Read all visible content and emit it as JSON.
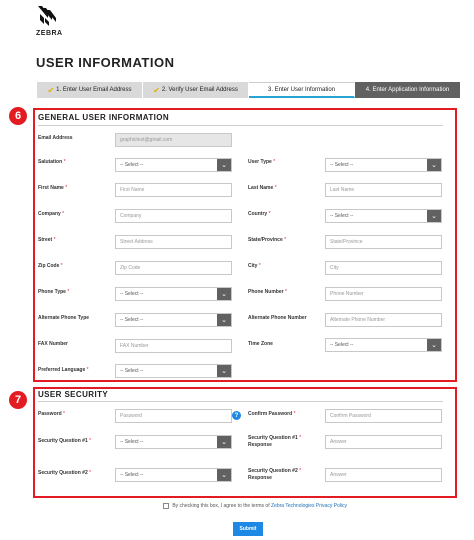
{
  "brand": {
    "name": "ZEBRA"
  },
  "page_title": "USER INFORMATION",
  "steps": [
    {
      "label": "1. Enter User Email Address",
      "done": true
    },
    {
      "label": "2. Verify User Email Address",
      "done": true
    },
    {
      "label": "3. Enter User Information",
      "active": true
    },
    {
      "label": "4. Enter Application Information"
    }
  ],
  "callouts": {
    "general": "6",
    "security": "7"
  },
  "general": {
    "title": "GENERAL USER INFORMATION",
    "email_label": "Email Address",
    "email_value": "graphictest@gmail.com",
    "salutation_label": "Salutation",
    "salutation_value": "-- Select --",
    "user_type_label": "User Type",
    "user_type_value": "-- Select --",
    "first_name_label": "First Name",
    "first_name_placeholder": "First Name",
    "last_name_label": "Last Name",
    "last_name_placeholder": "Last Name",
    "company_label": "Company",
    "company_placeholder": "Company",
    "country_label": "Country",
    "country_value": "-- Select --",
    "street_label": "Street",
    "street_placeholder": "Street Address",
    "state_label": "State/Province",
    "state_placeholder": "State/Province",
    "zip_label": "Zip Code",
    "zip_placeholder": "Zip Code",
    "city_label": "City",
    "city_placeholder": "City",
    "phone_type_label": "Phone Type",
    "phone_type_value": "-- Select --",
    "phone_number_label": "Phone Number",
    "phone_number_placeholder": "Phone Number",
    "alt_phone_type_label": "Alternate Phone Type",
    "alt_phone_type_value": "-- Select --",
    "alt_phone_number_label": "Alternate Phone Number",
    "alt_phone_number_placeholder": "Alternate Phone Number",
    "fax_label": "FAX Number",
    "fax_placeholder": "FAX Number",
    "time_zone_label": "Time Zone",
    "time_zone_value": "-- Select --",
    "language_label": "Preferred Language",
    "language_value": "-- Select --"
  },
  "security": {
    "title": "USER SECURITY",
    "password_label": "Password",
    "password_placeholder": "Password",
    "help_icon": "?",
    "confirm_label": "Confirm Password",
    "confirm_placeholder": "Confirm Password",
    "q1_label": "Security Question #1",
    "q1_value": "-- Select --",
    "q1_resp_label_line1": "Security Question #1",
    "q1_resp_label_line2": "Response",
    "q1_resp_placeholder": "Answer",
    "q2_label": "Security Question #2",
    "q2_value": "-- Select --",
    "q2_resp_label_line1": "Security Question #2",
    "q2_resp_label_line2": "Response",
    "q2_resp_placeholder": "Answer"
  },
  "consent": {
    "text": "By checking this box, I agree to the terms of",
    "link": "Zebra Technologies Privacy Policy"
  },
  "submit_label": "Submit",
  "colors": {
    "accent": "#e31b23",
    "primary": "#1e88e5",
    "step_dark": "#616161",
    "check": "#e0b000"
  }
}
